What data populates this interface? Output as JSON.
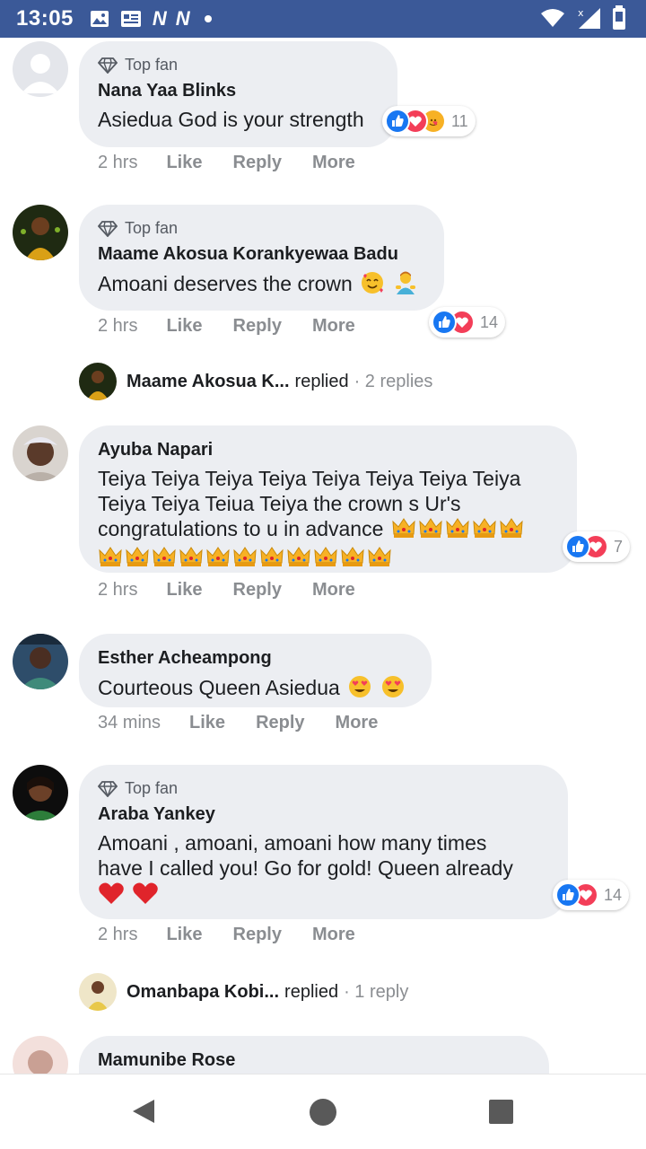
{
  "status_bar": {
    "time": "13:05",
    "left_icons": [
      "image-icon",
      "news-icon",
      "n-icon",
      "n-icon",
      "dot-icon"
    ],
    "n_letter": "N",
    "right_icons": [
      "wifi-icon",
      "signal-icon",
      "battery-icon"
    ]
  },
  "colors": {
    "status_bar": "#3b5998",
    "bubble": "#eceef2",
    "like_blue": "#1877f2",
    "love_red": "#f33e58",
    "muted_text": "#8a8d91"
  },
  "labels": {
    "top_fan": "Top fan",
    "like": "Like",
    "reply": "Reply",
    "more": "More"
  },
  "comments": [
    {
      "author": "Nana Yaa Blinks",
      "top_fan": true,
      "text": "Asiedua God is your strength",
      "reactions": [
        "like",
        "love",
        "care"
      ],
      "reaction_count": "11",
      "time": "2 hrs"
    },
    {
      "author": "Maame Akosua Korankyewaa Badu",
      "top_fan": true,
      "text": "Amoani deserves the crown",
      "emojis": [
        "smiling-face-with-hearts-emoji",
        "person-gesturing-emoji"
      ],
      "reactions": [
        "like",
        "love"
      ],
      "reaction_count": "14",
      "time": "2 hrs",
      "replies": {
        "name": "Maame Akosua K...",
        "action": "replied",
        "count": "· 2 replies"
      }
    },
    {
      "author": "Ayuba Napari",
      "top_fan": false,
      "text_lines": [
        "Teiya Teiya Teiya Teiya Teiya Teiya Teiya Teiya",
        "Teiya Teiya Teiua Teiya the crown s Ur's",
        "congratulations to u in advance"
      ],
      "emojis": [
        "crown-emoji",
        "crown-emoji",
        "crown-emoji",
        "crown-emoji",
        "crown-emoji",
        "crown-emoji",
        "crown-emoji",
        "crown-emoji",
        "crown-emoji",
        "crown-emoji",
        "crown-emoji",
        "crown-emoji",
        "crown-emoji",
        "crown-emoji",
        "crown-emoji",
        "crown-emoji"
      ],
      "reactions": [
        "like",
        "love"
      ],
      "reaction_count": "7",
      "time": "2 hrs"
    },
    {
      "author": "Esther Acheampong",
      "top_fan": false,
      "text": "Courteous Queen Asiedua",
      "emojis": [
        "heart-eyes-emoji",
        "heart-eyes-emoji"
      ],
      "time": "34 mins"
    },
    {
      "author": "Araba Yankey",
      "top_fan": true,
      "text_lines": [
        "Amoani , amoani, amoani how many times",
        "have I called you! Go for gold! Queen already"
      ],
      "emojis": [
        "red-heart-emoji",
        "red-heart-emoji"
      ],
      "reactions": [
        "like",
        "love"
      ],
      "reaction_count": "14",
      "time": "2 hrs",
      "replies": {
        "name": "Omanbapa Kobi...",
        "action": "replied",
        "count": "· 1 reply"
      }
    },
    {
      "author": "Mamunibe Rose",
      "top_fan": false,
      "partial": true
    }
  ],
  "nav_bar": {
    "back": "back-icon",
    "home": "home-icon",
    "recents": "recents-icon"
  }
}
